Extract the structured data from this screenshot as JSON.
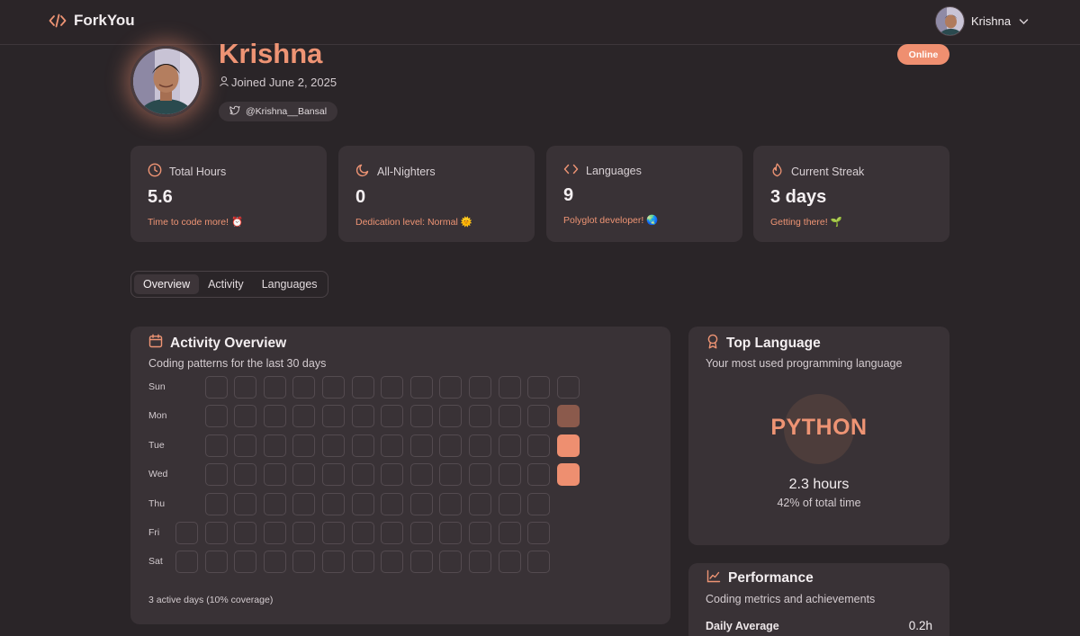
{
  "nav": {
    "brand": "ForkYou",
    "username": "Krishna",
    "icons": [
      "code-icon",
      "avatar",
      "chevron-down-icon"
    ]
  },
  "profile": {
    "name": "Krishna",
    "joined": "Joined June 2, 2025",
    "twitter_handle": "@Krishna__Bansal",
    "status": "Online"
  },
  "stats": [
    {
      "icon": "clock-icon",
      "label": "Total Hours",
      "value": "5.6",
      "note": "Time to code more! ⏰"
    },
    {
      "icon": "moon-icon",
      "label": "All-Nighters",
      "value": "0",
      "note": "Dedication level: Normal 🌞"
    },
    {
      "icon": "code-icon",
      "label": "Languages",
      "value": "9",
      "note": "Polyglot developer! 🌏"
    },
    {
      "icon": "flame-icon",
      "label": "Current Streak",
      "value": "3 days",
      "note": "Getting there! 🌱"
    }
  ],
  "tabs": [
    "Overview",
    "Activity",
    "Languages"
  ],
  "active_tab": "Overview",
  "activity": {
    "title": "Activity Overview",
    "subtitle": "Coding patterns for the last 30 days",
    "days": [
      "Sun",
      "Mon",
      "Tue",
      "Wed",
      "Thu",
      "Fri",
      "Sat"
    ],
    "active_days": [
      {
        "day": "Mon",
        "level": 2
      },
      {
        "day": "Tue",
        "level": 3
      },
      {
        "day": "Wed",
        "level": 3
      }
    ],
    "footer": "3 active days (10% coverage)",
    "colors": {
      "empty_border": "#544b50",
      "level2": "#8b5a4c",
      "level3": "#ee8f70"
    }
  },
  "top_language": {
    "title": "Top Language",
    "subtitle": "Your most used programming language",
    "language": "PYTHON",
    "hours": "2.3 hours",
    "share": "42% of total time"
  },
  "performance": {
    "title": "Performance",
    "subtitle": "Coding metrics and achievements",
    "metrics": [
      {
        "label": "Daily Average",
        "value": "0.2h"
      }
    ]
  },
  "colors": {
    "accent": "#ee9474",
    "background": "#2a2528",
    "card": "#393236"
  }
}
